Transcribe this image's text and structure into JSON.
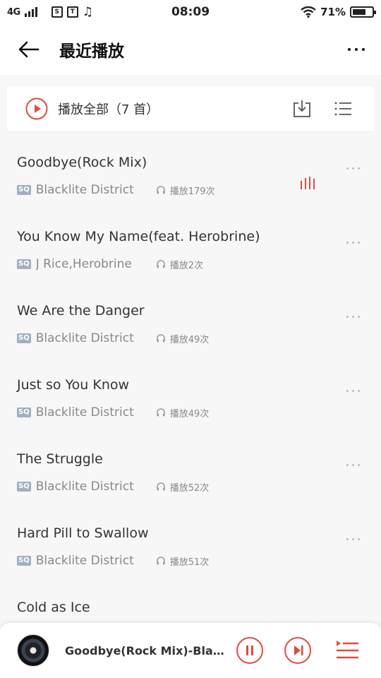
{
  "status_bar": {
    "network": "4G",
    "time": "08:09",
    "battery": "71%",
    "battery_level": 0.71,
    "sim_icon": "S",
    "ticket_icon": "T",
    "music_icon": "♫"
  },
  "header": {
    "title": "最近播放"
  },
  "play_all": {
    "label": "播放全部（7 首）"
  },
  "songs": [
    {
      "title": "Goodbye(Rock Mix)",
      "quality": "SQ",
      "artist": "Blacklite District",
      "plays": "播放179次",
      "playing": true
    },
    {
      "title": "You Know My Name(feat. Herobrine)",
      "quality": "SQ",
      "artist": "J Rice,Herobrine",
      "plays": "播放2次",
      "playing": false
    },
    {
      "title": "We Are the Danger",
      "quality": "SQ",
      "artist": "Blacklite District",
      "plays": "播放49次",
      "playing": false
    },
    {
      "title": "Just so You Know",
      "quality": "SQ",
      "artist": "Blacklite District",
      "plays": "播放49次",
      "playing": false
    },
    {
      "title": "The Struggle",
      "quality": "SQ",
      "artist": "Blacklite District",
      "plays": "播放52次",
      "playing": false
    },
    {
      "title": "Hard Pill to Swallow",
      "quality": "SQ",
      "artist": "Blacklite District",
      "plays": "播放51次",
      "playing": false
    },
    {
      "title": "Cold as Ice",
      "quality": "",
      "artist": "",
      "plays": "",
      "playing": false
    }
  ],
  "player": {
    "now_playing": "Goodbye(Rock Mix)-Blackl..."
  },
  "colors": {
    "accent": "#e04b3f",
    "sq_badge": "#9fb0c2",
    "text_secondary": "#888888"
  }
}
